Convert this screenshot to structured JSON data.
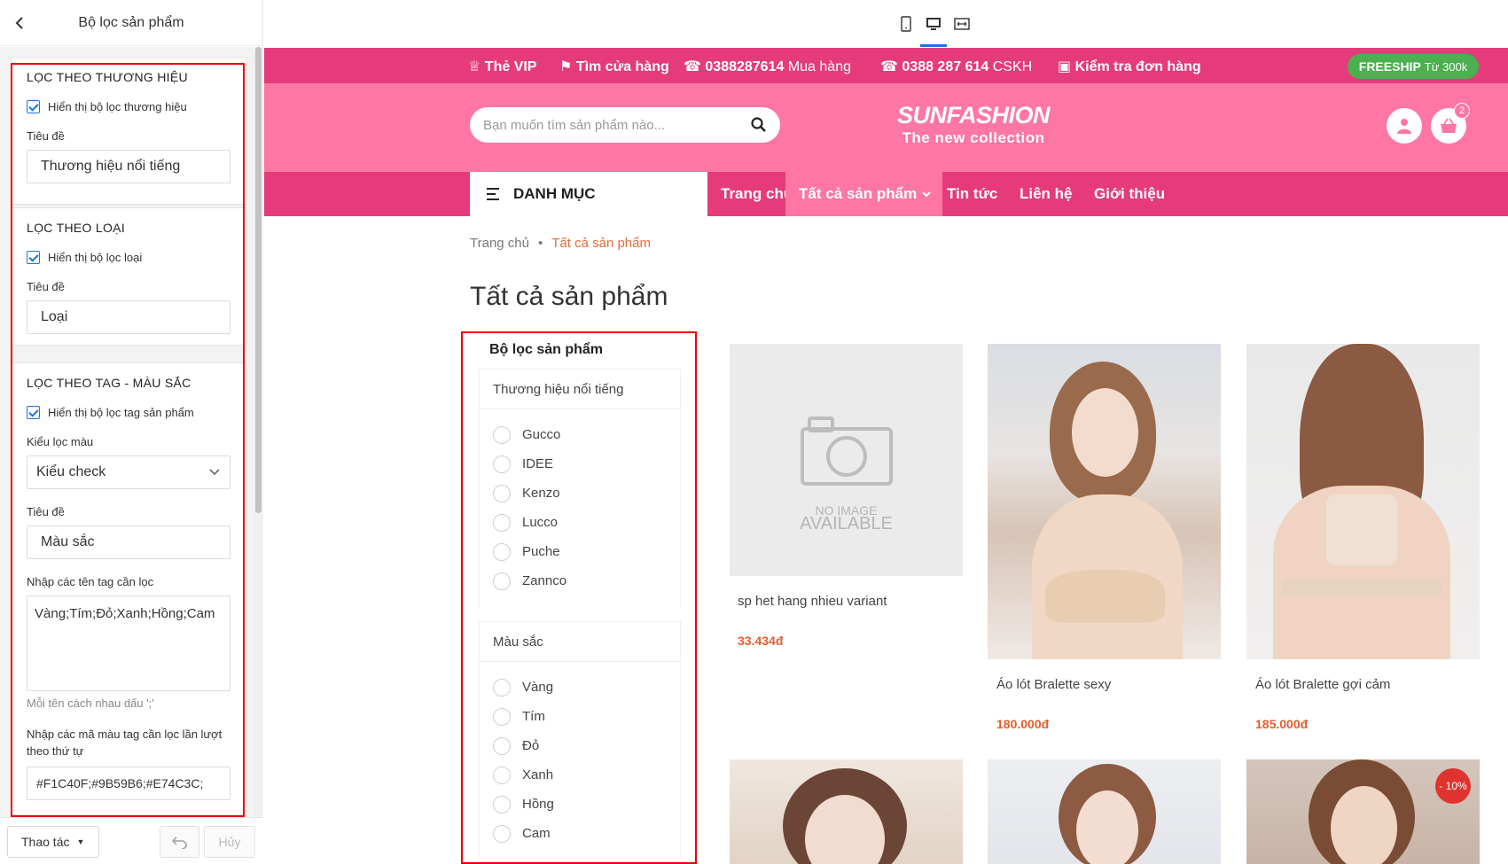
{
  "editor": {
    "title": "Bộ lọc sản phẩm",
    "brand": {
      "heading": "LỌC THEO THƯƠNG HIỆU",
      "checkbox_label": "Hiển thị bộ lọc thương hiệu",
      "title_label": "Tiêu đề",
      "title_value": "Thương hiệu nổi tiếng"
    },
    "type": {
      "heading": "LỌC THEO LOẠI",
      "checkbox_label": "Hiển thị bộ lọc loại",
      "title_label": "Tiêu đề",
      "title_value": "Loại"
    },
    "tag": {
      "heading": "LỌC THEO TAG - MÀU SẮC",
      "checkbox_label": "Hiển thị bộ lọc tag sản phẩm",
      "color_style_label": "Kiểu lọc màu",
      "color_style_value": "Kiểu check",
      "title_label": "Tiêu đề",
      "title_value": "Màu sắc",
      "tags_label": "Nhập các tên tag cần lọc",
      "tags_value": "Vàng;Tím;Đỏ;Xanh;Hồng;Cam",
      "tags_hint": "Mỗi tên cách nhau dấu ';'",
      "codes_label": "Nhập các mã màu tag cần lọc lần lượt theo thứ tự",
      "codes_value": "#F1C40F;#9B59B6;#E74C3C;"
    },
    "footer": {
      "actions_label": "Thao tác",
      "cancel_label": "Hủy"
    }
  },
  "store": {
    "topbar": {
      "vip": "Thẻ VIP",
      "stores": "Tìm cửa hàng",
      "phone1": "0388287614",
      "phone1_suffix": "Mua hàng",
      "phone2": "0388 287 614",
      "phone2_suffix": "CSKH",
      "orders": "Kiểm tra đơn hàng",
      "freeship": "FREESHIP",
      "freeship_suffix": "Từ 300k"
    },
    "search_placeholder": "Bạn muốn tìm sản phẩm nào...",
    "logo_main": "SUNFASHION",
    "logo_sub": "The new collection",
    "cart_count": "2",
    "nav": {
      "category": "DANH MỤC",
      "items": [
        "Trang chủ",
        "Tất cả sản phẩm",
        "Tin tức",
        "Liên hệ",
        "Giới thiệu"
      ]
    },
    "breadcrumb": {
      "home": "Trang chủ",
      "current": "Tất cả sản phẩm"
    },
    "page_title": "Tất cả sản phẩm",
    "filter": {
      "title": "Bộ lọc sản phẩm",
      "brand_group": "Thương hiệu nổi tiếng",
      "brands": [
        "Gucco",
        "IDEE",
        "Kenzo",
        "Lucco",
        "Puche",
        "Zannco"
      ],
      "color_group": "Màu sắc",
      "colors": [
        "Vàng",
        "Tím",
        "Đỏ",
        "Xanh",
        "Hồng",
        "Cam"
      ]
    },
    "products": [
      {
        "name": "sp het hang nhieu variant",
        "price": "33.434đ",
        "noimage_top": "NO IMAGE",
        "noimage_bottom": "AVAILABLE"
      },
      {
        "name": "Áo lót Bralette sexy",
        "price": "180.000đ"
      },
      {
        "name": "Áo lót Bralette gợi cảm",
        "price": "185.000đ"
      }
    ],
    "sale_badge": "- 10%"
  }
}
